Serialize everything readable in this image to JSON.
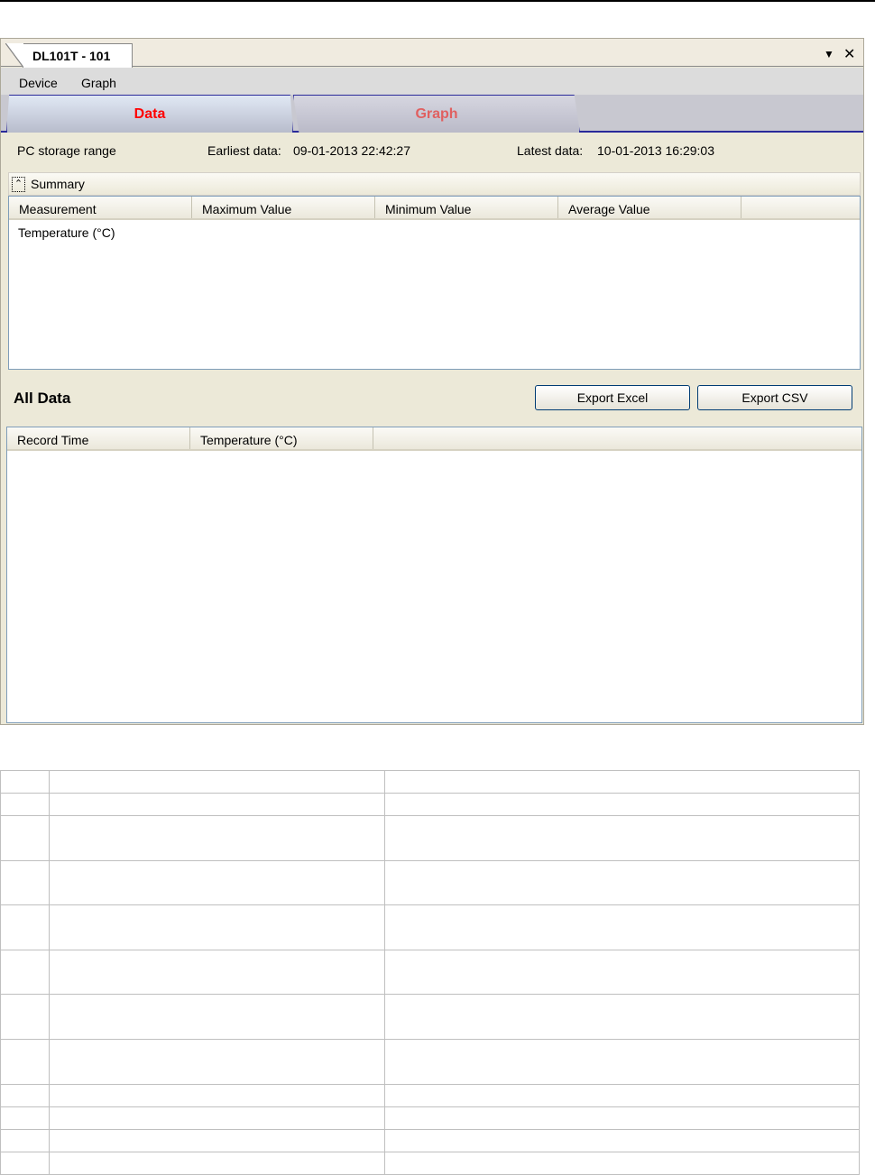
{
  "window": {
    "doc_tab": "DL101T - 101",
    "dropdown_icon": "triangle-down",
    "close_icon": "close"
  },
  "menu": [
    "Device",
    "Graph"
  ],
  "tabs": [
    {
      "label": "Data",
      "active": true
    },
    {
      "label": "Graph",
      "active": false
    }
  ],
  "storage": {
    "label": "PC storage range",
    "earliest_label": "Earliest data:",
    "earliest_value": "09-01-2013 22:42:27",
    "latest_label": "Latest data:",
    "latest_value": "10-01-2013 16:29:03"
  },
  "summary": {
    "title": "Summary",
    "columns": [
      "Measurement",
      "Maximum Value",
      "Minimum Value",
      "Average Value"
    ],
    "rows": [
      [
        "Temperature (°C)",
        "",
        "",
        ""
      ]
    ]
  },
  "all_data": {
    "title": "All Data",
    "export_excel": "Export Excel",
    "export_csv": "Export CSV",
    "columns": [
      "Record Time",
      "Temperature (°C)"
    ]
  },
  "doc_table": {
    "rows": 12
  }
}
